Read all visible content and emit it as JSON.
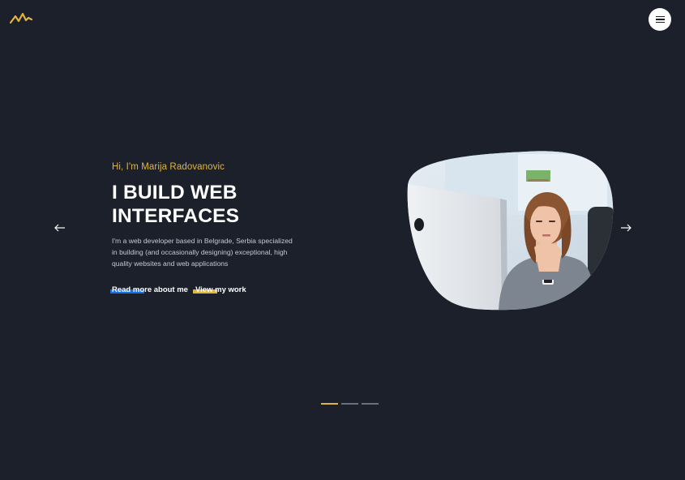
{
  "brand": {
    "logo_icon": "zigzag-logo-icon",
    "accent": "#e0b43e"
  },
  "nav": {
    "menu_icon": "hamburger-menu-icon"
  },
  "hero": {
    "greeting": "Hi, I'm Marija Radovanovic",
    "headline_line1": "I BUILD WEB",
    "headline_line2": "INTERFACES",
    "description": "I'm a web developer based in Belgrade, Serbia specialized in building (and occasionally designing) exceptional, high quality websites and web applications",
    "cta_about": "Read more about me",
    "cta_work": "View my work",
    "cta_about_color": "#1a6fe0",
    "cta_work_color": "#e0b43e"
  },
  "slider": {
    "prev_icon": "arrow-left-icon",
    "next_icon": "arrow-right-icon",
    "slide_count": 3,
    "active_slide": 1
  },
  "colors": {
    "background": "#1c202b",
    "text": "#ffffff",
    "muted": "#c7c9d1"
  }
}
